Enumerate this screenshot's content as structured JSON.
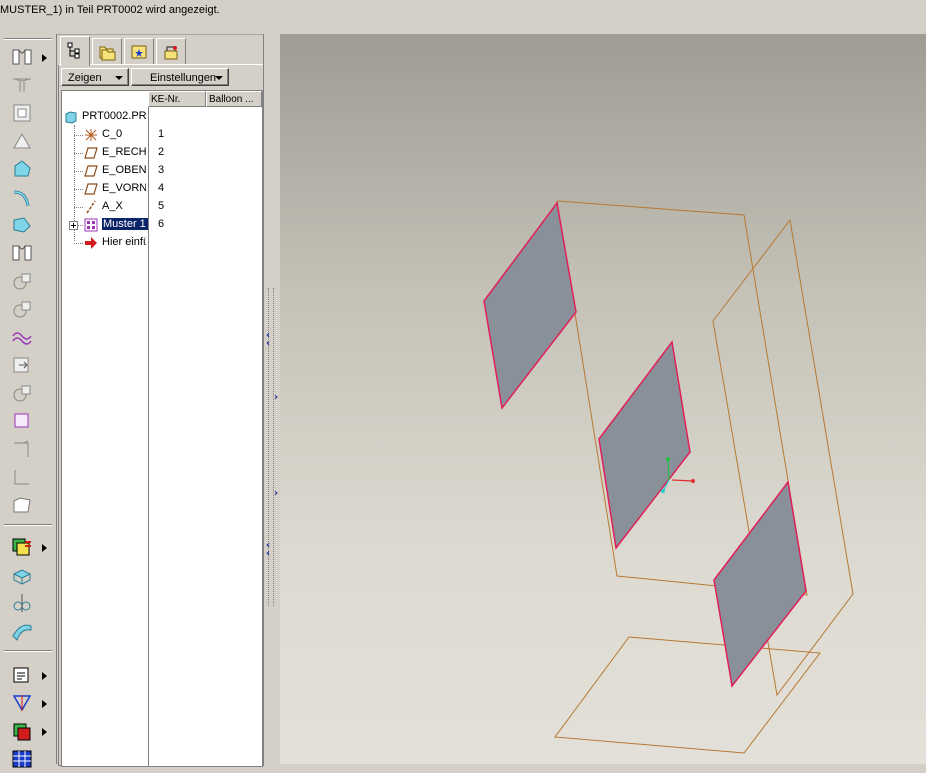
{
  "message_bar": {
    "text": "MUSTER_1) in Teil PRT0002 wird angezeigt."
  },
  "left_toolbar": {
    "buttons": [
      {
        "icon": "extrude-icon",
        "has_menu": true
      },
      {
        "icon": "rib-icon"
      },
      {
        "icon": "shell-icon"
      },
      {
        "icon": "draft-icon"
      },
      {
        "icon": "round-icon"
      },
      {
        "icon": "round-edge-icon"
      },
      {
        "icon": "chamfer-icon"
      },
      {
        "icon": "mirror-icon"
      },
      {
        "icon": "revolve-icon"
      },
      {
        "icon": "sweep-icon"
      },
      {
        "icon": "wave-surface-icon"
      },
      {
        "icon": "offset-icon"
      },
      {
        "icon": "rotate-copy-icon"
      },
      {
        "icon": "boundary-square-icon"
      },
      {
        "icon": "trim-icon"
      },
      {
        "icon": "flat-sheet-icon"
      },
      {
        "icon": "face-icon"
      },
      {
        "icon": "pattern-icon",
        "has_menu": true
      },
      {
        "icon": "transform-icon"
      },
      {
        "icon": "split-icon"
      },
      {
        "icon": "warp-icon"
      },
      {
        "icon": "measure-icon",
        "has_menu": true
      },
      {
        "icon": "analysis-icon",
        "has_menu": true
      },
      {
        "icon": "layer-icon",
        "has_menu": true
      },
      {
        "icon": "grid-icon"
      }
    ]
  },
  "tree_panel": {
    "tabs": [
      {
        "icon": "model-tree-icon",
        "active": true
      },
      {
        "icon": "folder-browser-icon"
      },
      {
        "icon": "favorites-icon"
      },
      {
        "icon": "connections-icon"
      }
    ],
    "menu_buttons": {
      "show": "Zeigen",
      "settings": "Einstellungen"
    },
    "columns": [
      "KE-Nr.",
      "Balloon ..."
    ],
    "items": [
      {
        "name": "PRT0002.PR",
        "number": "",
        "icon": "part-icon"
      },
      {
        "name": "C_0",
        "number": "1",
        "icon": "coordinate-system-icon"
      },
      {
        "name": "E_RECH",
        "number": "2",
        "icon": "datum-plane-icon"
      },
      {
        "name": "E_OBEN",
        "number": "3",
        "icon": "datum-plane-icon"
      },
      {
        "name": "E_VORN",
        "number": "4",
        "icon": "datum-plane-icon"
      },
      {
        "name": "A_X",
        "number": "5",
        "icon": "datum-axis-icon"
      },
      {
        "name": "Muster 1",
        "number": "6",
        "icon": "pattern-icon",
        "selected": true,
        "expandable": true
      },
      {
        "name": "Hier einfü",
        "number": "",
        "icon": "insert-here-arrow-icon"
      }
    ]
  },
  "colors": {
    "surface_fill": "#8a9099",
    "surface_edge": "#e0205a",
    "datum_plane": "#b87834",
    "selection": "#0a246a",
    "axis_x": "#e03030",
    "axis_y": "#20c040",
    "axis_z": "#20d0d0"
  }
}
